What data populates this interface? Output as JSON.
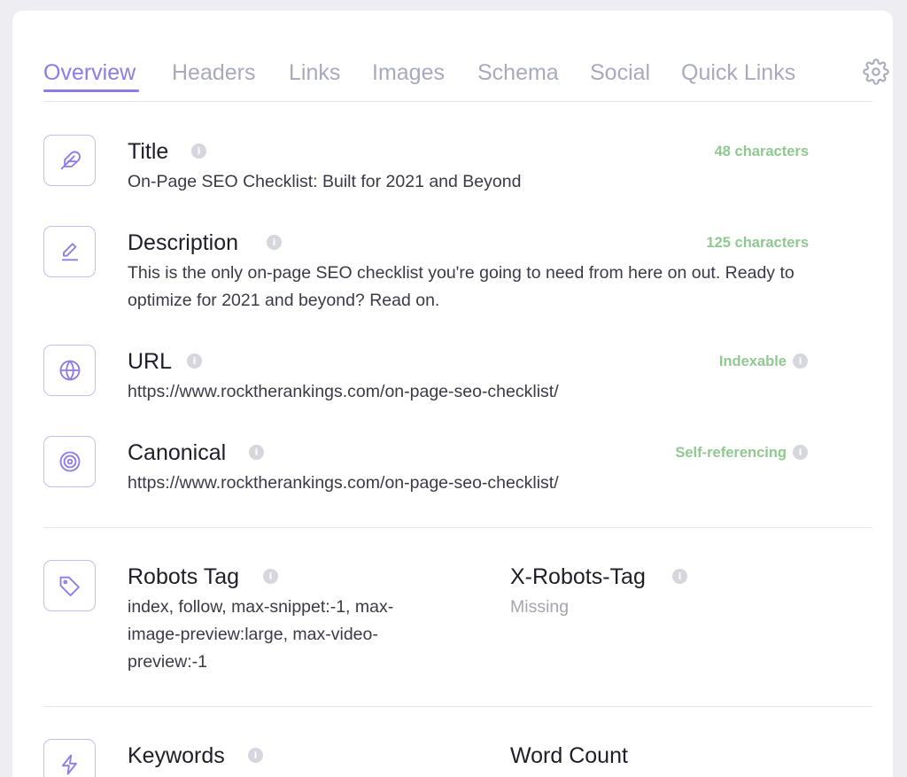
{
  "tabs": [
    {
      "label": "Overview",
      "active": true
    },
    {
      "label": "Headers",
      "active": false
    },
    {
      "label": "Links",
      "active": false
    },
    {
      "label": "Images",
      "active": false
    },
    {
      "label": "Schema",
      "active": false
    },
    {
      "label": "Social",
      "active": false
    },
    {
      "label": "Quick Links",
      "active": false
    }
  ],
  "settings_icon": "gear-icon",
  "info_glyph": "i",
  "colors": {
    "accent": "#8c7ce8",
    "tab_inactive": "#a8aabd",
    "status_good": "#90c990",
    "icon_border": "#c4bdf2",
    "muted_text": "#a5a5b2"
  },
  "rows": {
    "title": {
      "icon": "feather-icon",
      "label": "Title",
      "value": "On-Page SEO Checklist: Built for 2021 and Beyond",
      "stat": "48 characters"
    },
    "description": {
      "icon": "pencil-icon",
      "label": "Description",
      "value": "This is the only on-page SEO checklist you're going to need from here on out. Ready to optimize for 2021 and beyond? Read on.",
      "stat": "125 characters"
    },
    "url": {
      "icon": "globe-icon",
      "label": "URL",
      "value": "https://www.rocktherankings.com/on-page-seo-checklist/",
      "stat": "Indexable"
    },
    "canonical": {
      "icon": "target-icon",
      "label": "Canonical",
      "value": "https://www.rocktherankings.com/on-page-seo-checklist/",
      "stat": "Self-referencing"
    },
    "robots": {
      "icon": "tag-icon",
      "label": "Robots Tag",
      "value": "index, follow, max-snippet:-1, max-image-preview:large, max-video-preview:-1"
    },
    "x_robots": {
      "label": "X-Robots-Tag",
      "value": "Missing"
    },
    "keywords": {
      "icon": "lightning-icon",
      "label": "Keywords"
    },
    "word_count": {
      "label": "Word Count"
    }
  }
}
